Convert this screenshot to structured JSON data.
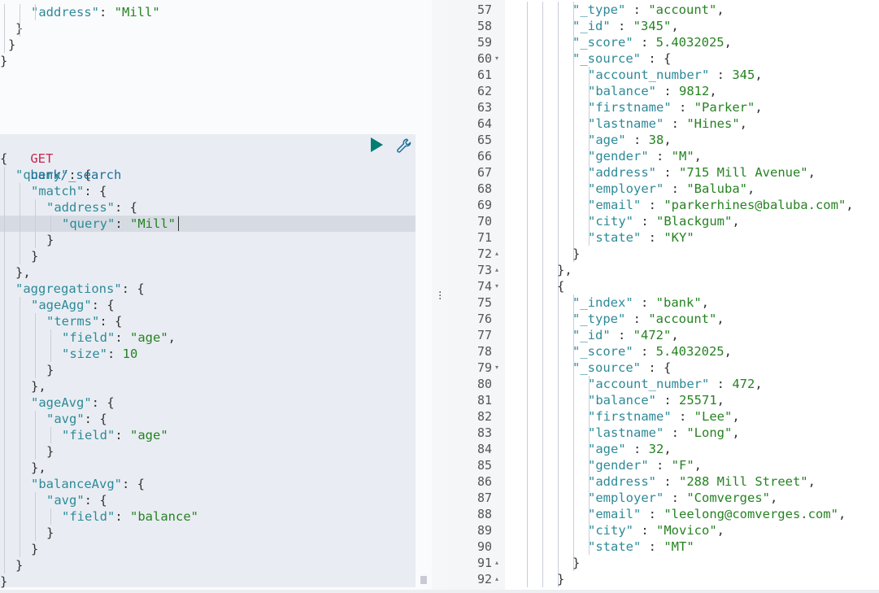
{
  "left": {
    "top_lines": [
      {
        "indent": 2,
        "parts": [
          [
            "k",
            "\"address\""
          ],
          [
            "p",
            ": "
          ],
          [
            "s",
            "\"Mill\""
          ]
        ]
      },
      {
        "indent": 1,
        "parts": [
          [
            "p",
            "}"
          ]
        ]
      },
      {
        "indent": 0.5,
        "parts": [
          [
            "p",
            "}"
          ]
        ]
      },
      {
        "indent": 0,
        "parts": [
          [
            "p",
            "}"
          ]
        ]
      }
    ],
    "request": {
      "method": "GET",
      "url": "bank/_search",
      "body_lines": [
        {
          "indent": 0,
          "parts": [
            [
              "p",
              "{"
            ]
          ]
        },
        {
          "indent": 1,
          "parts": [
            [
              "k",
              "\"query\""
            ],
            [
              "p",
              ": {"
            ]
          ]
        },
        {
          "indent": 2,
          "parts": [
            [
              "k",
              "\"match\""
            ],
            [
              "p",
              ": {"
            ]
          ]
        },
        {
          "indent": 3,
          "parts": [
            [
              "k",
              "\"address\""
            ],
            [
              "p",
              ": {"
            ]
          ]
        },
        {
          "indent": 4,
          "parts": [
            [
              "k",
              "\"query\""
            ],
            [
              "p",
              ": "
            ],
            [
              "s",
              "\"Mill\""
            ]
          ]
        },
        {
          "indent": 3,
          "parts": [
            [
              "p",
              "}"
            ]
          ]
        },
        {
          "indent": 2,
          "parts": [
            [
              "p",
              "}"
            ]
          ]
        },
        {
          "indent": 1,
          "parts": [
            [
              "p",
              "},"
            ]
          ]
        },
        {
          "indent": 1,
          "parts": [
            [
              "k",
              "\"aggregations\""
            ],
            [
              "p",
              ": {"
            ]
          ]
        },
        {
          "indent": 2,
          "parts": [
            [
              "k",
              "\"ageAgg\""
            ],
            [
              "p",
              ": {"
            ]
          ]
        },
        {
          "indent": 3,
          "parts": [
            [
              "k",
              "\"terms\""
            ],
            [
              "p",
              ": {"
            ]
          ]
        },
        {
          "indent": 4,
          "parts": [
            [
              "k",
              "\"field\""
            ],
            [
              "p",
              ": "
            ],
            [
              "s",
              "\"age\""
            ],
            [
              "p",
              ","
            ]
          ]
        },
        {
          "indent": 4,
          "parts": [
            [
              "k",
              "\"size\""
            ],
            [
              "p",
              ": "
            ],
            [
              "n",
              "10"
            ]
          ]
        },
        {
          "indent": 3,
          "parts": [
            [
              "p",
              "}"
            ]
          ]
        },
        {
          "indent": 2,
          "parts": [
            [
              "p",
              "},"
            ]
          ]
        },
        {
          "indent": 2,
          "parts": [
            [
              "k",
              "\"ageAvg\""
            ],
            [
              "p",
              ": {"
            ]
          ]
        },
        {
          "indent": 3,
          "parts": [
            [
              "k",
              "\"avg\""
            ],
            [
              "p",
              ": {"
            ]
          ]
        },
        {
          "indent": 4,
          "parts": [
            [
              "k",
              "\"field\""
            ],
            [
              "p",
              ": "
            ],
            [
              "s",
              "\"age\""
            ]
          ]
        },
        {
          "indent": 3,
          "parts": [
            [
              "p",
              "}"
            ]
          ]
        },
        {
          "indent": 2,
          "parts": [
            [
              "p",
              "},"
            ]
          ]
        },
        {
          "indent": 2,
          "parts": [
            [
              "k",
              "\"balanceAvg\""
            ],
            [
              "p",
              ": {"
            ]
          ]
        },
        {
          "indent": 3,
          "parts": [
            [
              "k",
              "\"avg\""
            ],
            [
              "p",
              ": {"
            ]
          ]
        },
        {
          "indent": 4,
          "parts": [
            [
              "k",
              "\"field\""
            ],
            [
              "p",
              ": "
            ],
            [
              "s",
              "\"balance\""
            ]
          ]
        },
        {
          "indent": 3,
          "parts": [
            [
              "p",
              "}"
            ]
          ]
        },
        {
          "indent": 2,
          "parts": [
            [
              "p",
              "}"
            ]
          ]
        },
        {
          "indent": 1,
          "parts": [
            [
              "p",
              "}"
            ]
          ]
        },
        {
          "indent": 0,
          "parts": [
            [
              "p",
              "}"
            ]
          ]
        }
      ]
    },
    "icons": {
      "run": "play-icon",
      "settings": "wrench-icon"
    },
    "colors": {
      "run": "#017d73",
      "wrench": "#1f6f99",
      "method": "#c7254e"
    }
  },
  "right": {
    "lines": [
      {
        "num": "57",
        "fold": "",
        "indent": 4,
        "parts": [
          [
            "k",
            "\"_type\""
          ],
          [
            "p",
            " : "
          ],
          [
            "s",
            "\"account\""
          ],
          [
            "p",
            ","
          ]
        ]
      },
      {
        "num": "58",
        "fold": "",
        "indent": 4,
        "parts": [
          [
            "k",
            "\"_id\""
          ],
          [
            "p",
            " : "
          ],
          [
            "s",
            "\"345\""
          ],
          [
            "p",
            ","
          ]
        ]
      },
      {
        "num": "59",
        "fold": "",
        "indent": 4,
        "parts": [
          [
            "k",
            "\"_score\""
          ],
          [
            "p",
            " : "
          ],
          [
            "n",
            "5.4032025"
          ],
          [
            "p",
            ","
          ]
        ]
      },
      {
        "num": "60",
        "fold": "▾",
        "indent": 4,
        "parts": [
          [
            "k",
            "\"_source\""
          ],
          [
            "p",
            " : {"
          ]
        ]
      },
      {
        "num": "61",
        "fold": "",
        "indent": 5,
        "parts": [
          [
            "k",
            "\"account_number\""
          ],
          [
            "p",
            " : "
          ],
          [
            "n",
            "345"
          ],
          [
            "p",
            ","
          ]
        ]
      },
      {
        "num": "62",
        "fold": "",
        "indent": 5,
        "parts": [
          [
            "k",
            "\"balance\""
          ],
          [
            "p",
            " : "
          ],
          [
            "n",
            "9812"
          ],
          [
            "p",
            ","
          ]
        ]
      },
      {
        "num": "63",
        "fold": "",
        "indent": 5,
        "parts": [
          [
            "k",
            "\"firstname\""
          ],
          [
            "p",
            " : "
          ],
          [
            "s",
            "\"Parker\""
          ],
          [
            "p",
            ","
          ]
        ]
      },
      {
        "num": "64",
        "fold": "",
        "indent": 5,
        "parts": [
          [
            "k",
            "\"lastname\""
          ],
          [
            "p",
            " : "
          ],
          [
            "s",
            "\"Hines\""
          ],
          [
            "p",
            ","
          ]
        ]
      },
      {
        "num": "65",
        "fold": "",
        "indent": 5,
        "parts": [
          [
            "k",
            "\"age\""
          ],
          [
            "p",
            " : "
          ],
          [
            "n",
            "38"
          ],
          [
            "p",
            ","
          ]
        ]
      },
      {
        "num": "66",
        "fold": "",
        "indent": 5,
        "parts": [
          [
            "k",
            "\"gender\""
          ],
          [
            "p",
            " : "
          ],
          [
            "s",
            "\"M\""
          ],
          [
            "p",
            ","
          ]
        ]
      },
      {
        "num": "67",
        "fold": "",
        "indent": 5,
        "parts": [
          [
            "k",
            "\"address\""
          ],
          [
            "p",
            " : "
          ],
          [
            "s",
            "\"715 Mill Avenue\""
          ],
          [
            "p",
            ","
          ]
        ]
      },
      {
        "num": "68",
        "fold": "",
        "indent": 5,
        "parts": [
          [
            "k",
            "\"employer\""
          ],
          [
            "p",
            " : "
          ],
          [
            "s",
            "\"Baluba\""
          ],
          [
            "p",
            ","
          ]
        ]
      },
      {
        "num": "69",
        "fold": "",
        "indent": 5,
        "parts": [
          [
            "k",
            "\"email\""
          ],
          [
            "p",
            " : "
          ],
          [
            "s",
            "\"parkerhines@baluba.com\""
          ],
          [
            "p",
            ","
          ]
        ]
      },
      {
        "num": "70",
        "fold": "",
        "indent": 5,
        "parts": [
          [
            "k",
            "\"city\""
          ],
          [
            "p",
            " : "
          ],
          [
            "s",
            "\"Blackgum\""
          ],
          [
            "p",
            ","
          ]
        ]
      },
      {
        "num": "71",
        "fold": "",
        "indent": 5,
        "parts": [
          [
            "k",
            "\"state\""
          ],
          [
            "p",
            " : "
          ],
          [
            "s",
            "\"KY\""
          ]
        ]
      },
      {
        "num": "72",
        "fold": "▴",
        "indent": 4,
        "parts": [
          [
            "p",
            "}"
          ]
        ]
      },
      {
        "num": "73",
        "fold": "▴",
        "indent": 3,
        "parts": [
          [
            "p",
            "},"
          ]
        ]
      },
      {
        "num": "74",
        "fold": "▾",
        "indent": 3,
        "parts": [
          [
            "p",
            "{"
          ]
        ]
      },
      {
        "num": "75",
        "fold": "",
        "indent": 4,
        "parts": [
          [
            "k",
            "\"_index\""
          ],
          [
            "p",
            " : "
          ],
          [
            "s",
            "\"bank\""
          ],
          [
            "p",
            ","
          ]
        ]
      },
      {
        "num": "76",
        "fold": "",
        "indent": 4,
        "parts": [
          [
            "k",
            "\"_type\""
          ],
          [
            "p",
            " : "
          ],
          [
            "s",
            "\"account\""
          ],
          [
            "p",
            ","
          ]
        ]
      },
      {
        "num": "77",
        "fold": "",
        "indent": 4,
        "parts": [
          [
            "k",
            "\"_id\""
          ],
          [
            "p",
            " : "
          ],
          [
            "s",
            "\"472\""
          ],
          [
            "p",
            ","
          ]
        ]
      },
      {
        "num": "78",
        "fold": "",
        "indent": 4,
        "parts": [
          [
            "k",
            "\"_score\""
          ],
          [
            "p",
            " : "
          ],
          [
            "n",
            "5.4032025"
          ],
          [
            "p",
            ","
          ]
        ]
      },
      {
        "num": "79",
        "fold": "▾",
        "indent": 4,
        "parts": [
          [
            "k",
            "\"_source\""
          ],
          [
            "p",
            " : {"
          ]
        ]
      },
      {
        "num": "80",
        "fold": "",
        "indent": 5,
        "parts": [
          [
            "k",
            "\"account_number\""
          ],
          [
            "p",
            " : "
          ],
          [
            "n",
            "472"
          ],
          [
            "p",
            ","
          ]
        ]
      },
      {
        "num": "81",
        "fold": "",
        "indent": 5,
        "parts": [
          [
            "k",
            "\"balance\""
          ],
          [
            "p",
            " : "
          ],
          [
            "n",
            "25571"
          ],
          [
            "p",
            ","
          ]
        ]
      },
      {
        "num": "82",
        "fold": "",
        "indent": 5,
        "parts": [
          [
            "k",
            "\"firstname\""
          ],
          [
            "p",
            " : "
          ],
          [
            "s",
            "\"Lee\""
          ],
          [
            "p",
            ","
          ]
        ]
      },
      {
        "num": "83",
        "fold": "",
        "indent": 5,
        "parts": [
          [
            "k",
            "\"lastname\""
          ],
          [
            "p",
            " : "
          ],
          [
            "s",
            "\"Long\""
          ],
          [
            "p",
            ","
          ]
        ]
      },
      {
        "num": "84",
        "fold": "",
        "indent": 5,
        "parts": [
          [
            "k",
            "\"age\""
          ],
          [
            "p",
            " : "
          ],
          [
            "n",
            "32"
          ],
          [
            "p",
            ","
          ]
        ]
      },
      {
        "num": "85",
        "fold": "",
        "indent": 5,
        "parts": [
          [
            "k",
            "\"gender\""
          ],
          [
            "p",
            " : "
          ],
          [
            "s",
            "\"F\""
          ],
          [
            "p",
            ","
          ]
        ]
      },
      {
        "num": "86",
        "fold": "",
        "indent": 5,
        "parts": [
          [
            "k",
            "\"address\""
          ],
          [
            "p",
            " : "
          ],
          [
            "s",
            "\"288 Mill Street\""
          ],
          [
            "p",
            ","
          ]
        ]
      },
      {
        "num": "87",
        "fold": "",
        "indent": 5,
        "parts": [
          [
            "k",
            "\"employer\""
          ],
          [
            "p",
            " : "
          ],
          [
            "s",
            "\"Comverges\""
          ],
          [
            "p",
            ","
          ]
        ]
      },
      {
        "num": "88",
        "fold": "",
        "indent": 5,
        "parts": [
          [
            "k",
            "\"email\""
          ],
          [
            "p",
            " : "
          ],
          [
            "s",
            "\"leelong@comverges.com\""
          ],
          [
            "p",
            ","
          ]
        ]
      },
      {
        "num": "89",
        "fold": "",
        "indent": 5,
        "parts": [
          [
            "k",
            "\"city\""
          ],
          [
            "p",
            " : "
          ],
          [
            "s",
            "\"Movico\""
          ],
          [
            "p",
            ","
          ]
        ]
      },
      {
        "num": "90",
        "fold": "",
        "indent": 5,
        "parts": [
          [
            "k",
            "\"state\""
          ],
          [
            "p",
            " : "
          ],
          [
            "s",
            "\"MT\""
          ]
        ]
      },
      {
        "num": "91",
        "fold": "▴",
        "indent": 4,
        "parts": [
          [
            "p",
            "}"
          ]
        ]
      },
      {
        "num": "92",
        "fold": "▴",
        "indent": 3,
        "parts": [
          [
            "p",
            "}"
          ]
        ]
      }
    ]
  }
}
